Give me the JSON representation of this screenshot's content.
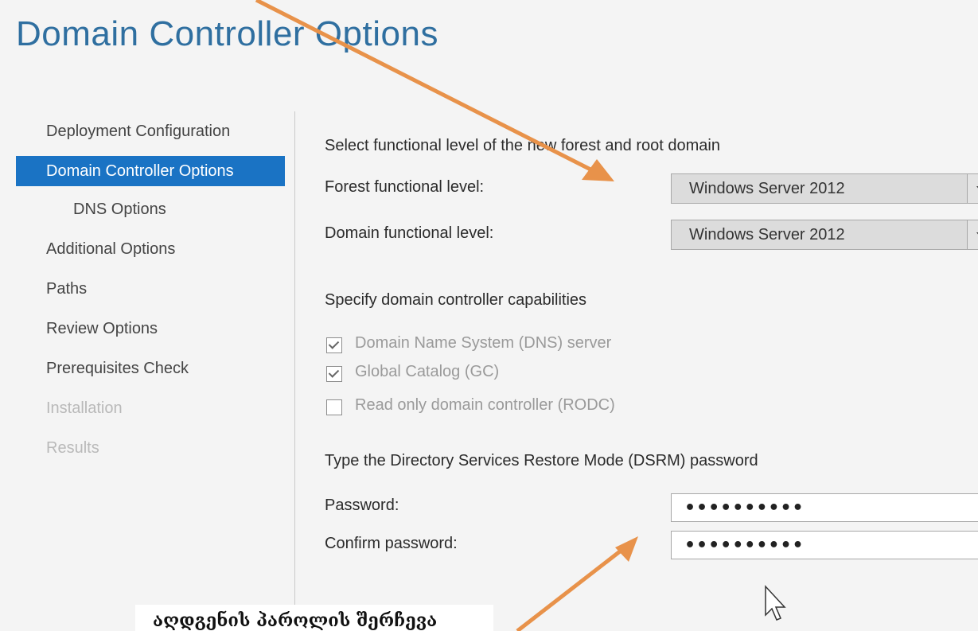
{
  "page": {
    "title": "Domain Controller Options"
  },
  "sidebar": {
    "items": [
      {
        "label": "Deployment Configuration",
        "state": "normal"
      },
      {
        "label": "Domain Controller Options",
        "state": "active"
      },
      {
        "label": "DNS Options",
        "state": "sub"
      },
      {
        "label": "Additional Options",
        "state": "normal"
      },
      {
        "label": "Paths",
        "state": "normal"
      },
      {
        "label": "Review Options",
        "state": "normal"
      },
      {
        "label": "Prerequisites Check",
        "state": "normal"
      },
      {
        "label": "Installation",
        "state": "disabled"
      },
      {
        "label": "Results",
        "state": "disabled"
      }
    ]
  },
  "functional_level": {
    "heading": "Select functional level of the new forest and root domain",
    "forest_label": "Forest functional level:",
    "forest_value": "Windows Server 2012",
    "domain_label": "Domain functional level:",
    "domain_value": "Windows Server 2012"
  },
  "capabilities": {
    "heading": "Specify domain controller capabilities",
    "options": [
      {
        "label": "Domain Name System (DNS) server",
        "checked": true
      },
      {
        "label": "Global Catalog (GC)",
        "checked": true
      },
      {
        "label": "Read only domain controller (RODC)",
        "checked": false
      }
    ]
  },
  "dsrm": {
    "heading": "Type the Directory Services Restore Mode (DSRM) password",
    "password_label": "Password:",
    "password_value": "••••••••••",
    "confirm_label": "Confirm password:",
    "confirm_value": "••••••••••"
  },
  "annotation": {
    "caption": "აღდგენის პაროლის შერჩევა",
    "arrow_color": "#e8924a"
  },
  "colors": {
    "title": "#2f6fa0",
    "active_item_bg": "#1a73c4"
  }
}
